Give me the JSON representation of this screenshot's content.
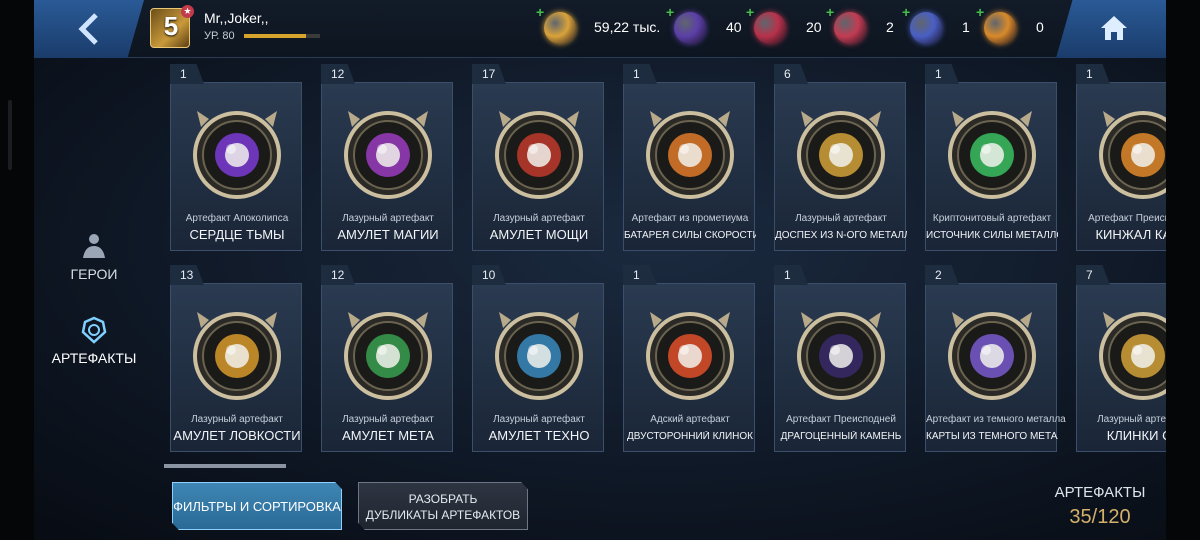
{
  "player": {
    "name": "Mr,,Joker,,",
    "level_badge": "5",
    "level_text": "УР. 80",
    "xp_fraction": 0.82
  },
  "currencies": [
    {
      "icon": "gold-credits-icon",
      "value": "59,22 тыс.",
      "color": "#d9a33a"
    },
    {
      "icon": "purple-crystal-icon",
      "value": "40",
      "color": "#5b3fa8"
    },
    {
      "icon": "red-crystal-icon",
      "value": "20",
      "color": "#b8324a"
    },
    {
      "icon": "red-planet-icon",
      "value": "2",
      "color": "#c23c52"
    },
    {
      "icon": "blue-planet-icon",
      "value": "1",
      "color": "#4a5fc4"
    },
    {
      "icon": "orange-sphere-icon",
      "value": "0",
      "color": "#d98a2a"
    }
  ],
  "sidenav": {
    "heroes": "ГЕРОИ",
    "artifacts": "АРТЕФАКТЫ"
  },
  "cards": [
    {
      "count": "1",
      "rarity": "Артефакт Апоколипса",
      "name": "СЕРДЦЕ ТЬМЫ",
      "accent": "#7c3cd6",
      "icon": "dark-crystal-icon",
      "small": false
    },
    {
      "count": "12",
      "rarity": "Лазурный артефакт",
      "name": "АМУЛЕТ МАГИИ",
      "accent": "#9b3cc0",
      "icon": "magic-amulet-icon",
      "small": false
    },
    {
      "count": "17",
      "rarity": "Лазурный артефакт",
      "name": "АМУЛЕТ МОЩИ",
      "accent": "#c0392b",
      "icon": "fist-amulet-icon",
      "small": false
    },
    {
      "count": "1",
      "rarity": "Артефакт из прометиума",
      "name": "БАТАРЕЯ СИЛЫ СКОРОСТИ",
      "accent": "#e07a2a",
      "icon": "speed-battery-icon",
      "small": true
    },
    {
      "count": "6",
      "rarity": "Лазурный артефакт",
      "name": "ДОСПЕХ ИЗ N-ОГО МЕТАЛЛА",
      "accent": "#d4a23a",
      "icon": "nth-metal-armor-icon",
      "small": true
    },
    {
      "count": "1",
      "rarity": "Криптонитовый артефакт",
      "name": "ИСТОЧНИК СИЛЫ МЕТАЛЛО",
      "accent": "#3ac060",
      "icon": "kryptonite-core-icon",
      "small": true
    },
    {
      "count": "1",
      "rarity": "Артефакт Преисподней",
      "name": "КИНЖАЛ КАМБ",
      "accent": "#e08a2a",
      "icon": "dagger-icon",
      "small": false
    },
    {
      "count": "13",
      "rarity": "Лазурный артефакт",
      "name": "АМУЛЕТ ЛОВКОСТИ",
      "accent": "#d89a2a",
      "icon": "boot-amulet-icon",
      "small": false
    },
    {
      "count": "12",
      "rarity": "Лазурный артефакт",
      "name": "АМУЛЕТ МЕТА",
      "accent": "#3aa050",
      "icon": "meta-amulet-icon",
      "small": false
    },
    {
      "count": "10",
      "rarity": "Лазурный артефакт",
      "name": "АМУЛЕТ ТЕХНО",
      "accent": "#3a8ac0",
      "icon": "techno-amulet-icon",
      "small": false
    },
    {
      "count": "1",
      "rarity": "Адский артефакт",
      "name": "ДВУСТОРОННИЙ КЛИНОК",
      "accent": "#e0502a",
      "icon": "double-blade-icon",
      "small": true
    },
    {
      "count": "1",
      "rarity": "Артефакт Преисподней",
      "name": "ДРАГОЦЕННЫЙ КАМЕНЬ",
      "accent": "#3a2a6a",
      "icon": "gem-icon",
      "small": true
    },
    {
      "count": "2",
      "rarity": "Артефакт из темного металла",
      "name": "КАРТЫ ИЗ ТЕМНОГО МЕТАЛЛА",
      "accent": "#7a5ad0",
      "icon": "cards-icon",
      "small": true
    },
    {
      "count": "7",
      "rarity": "Лазурный артефакт",
      "name": "КЛИНКИ СУ",
      "accent": "#d4a23a",
      "icon": "twin-blades-icon",
      "small": false
    }
  ],
  "buttons": {
    "filters": "ФИЛЬТРЫ И СОРТИРОВКА",
    "dupes_line1": "РАЗОБРАТЬ",
    "dupes_line2": "ДУБЛИКАТЫ АРТЕФАКТОВ"
  },
  "counter": {
    "label": "АРТЕФАКТЫ",
    "value": "35/120"
  }
}
